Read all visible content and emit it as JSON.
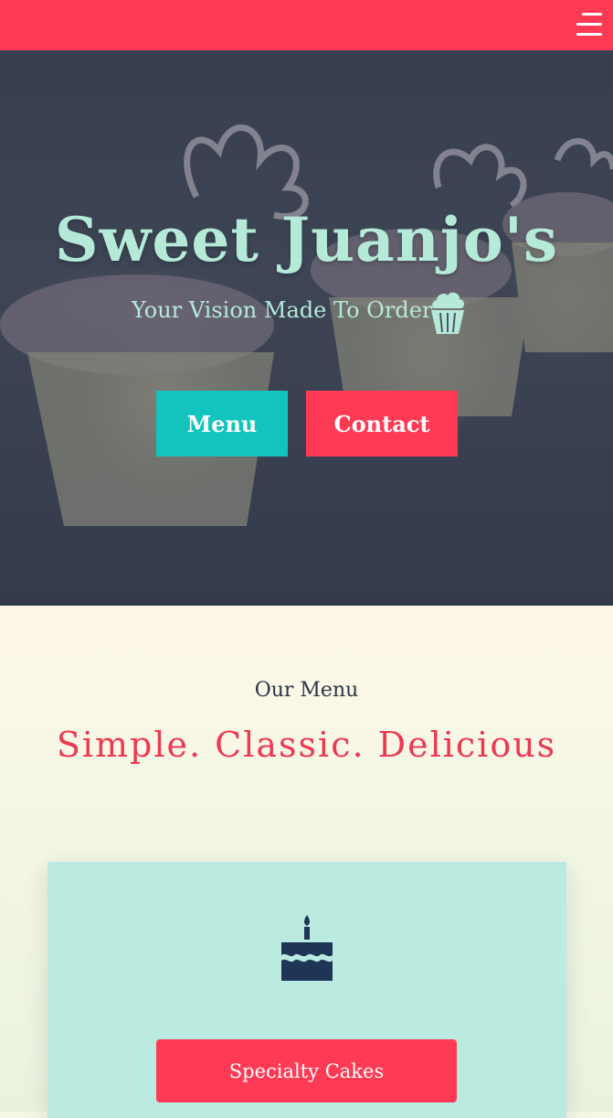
{
  "nav": {
    "menu_icon": "hamburger-menu-icon",
    "bar_color": "#ff3a55"
  },
  "hero": {
    "title": "Sweet Juanjo's",
    "subtitle": "Your Vision Made To Order",
    "subtitle_icon": "cupcake-icon",
    "menu_button": "Menu",
    "contact_button": "Contact",
    "background": "cupcakes-photo",
    "text_color": "#b5ead9",
    "menu_button_color": "#12c4bd",
    "contact_button_color": "#ff3a55"
  },
  "menu_section": {
    "kicker": "Our Menu",
    "heading": "Simple. Classic. Delicious",
    "heading_color": "#ec3a52",
    "cards": [
      {
        "icon": "birthday-cake-icon",
        "button": "Specialty Cakes",
        "card_color": "#bbeae0"
      }
    ]
  }
}
